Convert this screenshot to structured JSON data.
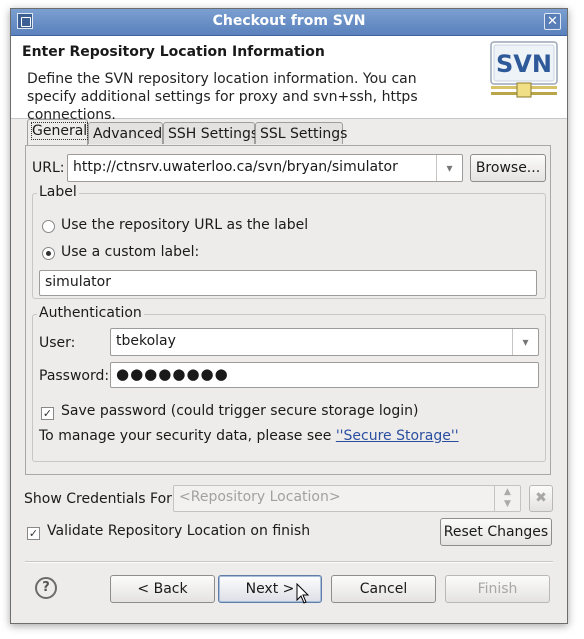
{
  "window": {
    "title": "Checkout from SVN",
    "close_glyph": "✕"
  },
  "header": {
    "title": "Enter Repository Location Information",
    "description": "Define the SVN repository location information. You can specify additional settings for proxy and svn+ssh, https connections.",
    "logo_text": "SVN"
  },
  "tabs": [
    {
      "label": "General",
      "underline_index": 0
    },
    {
      "label": "Advanced",
      "underline_index": 0
    },
    {
      "label": "SSH Settings",
      "underline_index": 2
    },
    {
      "label": "SSL Settings",
      "underline_index": 2
    }
  ],
  "url": {
    "label": "URL:",
    "value": "http://ctnsrv.uwaterloo.ca/svn/bryan/simulator",
    "browse_label": "Browse..."
  },
  "label_group": {
    "title": "Label",
    "option_repo": "Use the repository URL as the label",
    "option_custom": "Use a custom label:",
    "selected": "custom",
    "custom_value": "simulator"
  },
  "auth_group": {
    "title": "Authentication",
    "user_label": "User:",
    "user_value": "tbekolay",
    "password_label": "Password:",
    "password_mask": "●●●●●●●●",
    "save_password_label": "Save password (could trigger secure storage login)",
    "save_password_checked": true,
    "security_text": "To manage your security data, please see ",
    "security_link": "''Secure Storage''"
  },
  "credentials": {
    "label": "Show Credentials For:",
    "placeholder": "<Repository Location>"
  },
  "validate": {
    "label": "Validate Repository Location on finish",
    "checked": true
  },
  "buttons": {
    "reset": "Reset Changes",
    "back": "< Back",
    "next": "Next >",
    "cancel": "Cancel",
    "finish": "Finish",
    "help": "?"
  },
  "icons": {
    "app": "window-menu-icon",
    "close": "close-icon",
    "logo": "svn-logo",
    "help": "help-icon",
    "delete": "delete-icon",
    "spinner": "updown-spinner-icon",
    "cursor": "mouse-pointer-icon"
  },
  "colors": {
    "titlebar": "#5a81bd",
    "dialog_bg": "#edeceb",
    "link": "#2b4fa0"
  }
}
